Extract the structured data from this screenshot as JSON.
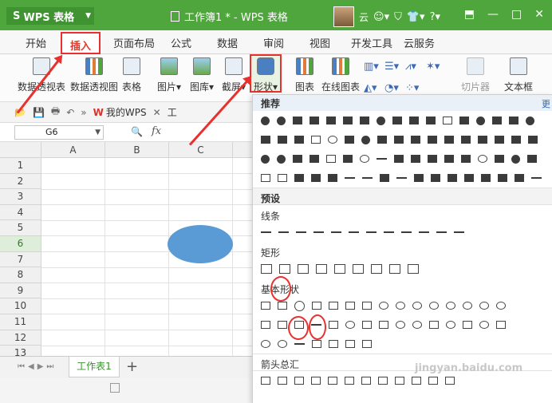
{
  "titlebar": {
    "app_name": "WPS 表格",
    "doc_title": "工作簿1 * - WPS 表格",
    "user_name": "云",
    "window_controls": [
      "restore-box",
      "minimize",
      "maximize",
      "close"
    ]
  },
  "menu": {
    "tabs": [
      "开始",
      "插入",
      "页面布局",
      "公式",
      "数据",
      "审阅",
      "视图",
      "开发工具",
      "云服务"
    ],
    "active_tab": "插入"
  },
  "ribbon": {
    "pivot_table": "数据透视表",
    "pivot_chart": "数据透视图",
    "table": "表格",
    "picture": "图片",
    "gallery": "图库",
    "screenshot": "截屏",
    "shapes": "形状",
    "chart": "图表",
    "online_chart": "在线图表",
    "slicer": "切片器",
    "textbox": "文本框"
  },
  "quick_access": {
    "my_wps": "我的WPS",
    "doc_tab_fragment": "工"
  },
  "formula_bar": {
    "name_box": "G6",
    "fx": "fx"
  },
  "grid": {
    "columns": [
      "A",
      "B",
      "C"
    ],
    "rows": [
      "1",
      "2",
      "3",
      "4",
      "5",
      "6",
      "7",
      "8",
      "9",
      "10",
      "11",
      "12",
      "13"
    ],
    "selected_row": "6"
  },
  "sheets": {
    "tab": "工作表1",
    "add": "+"
  },
  "shapes_panel": {
    "recommended": "推荐",
    "more": "更",
    "preset": "预设",
    "lines": "线条",
    "rectangles": "矩形",
    "basic_shapes": "基本形状",
    "block_arrows": "箭头总汇"
  },
  "watermark": "jingyan.baidu.com",
  "colors": {
    "titlebar": "#4fa63c",
    "highlight": "#e8312f",
    "ellipse": "#5b9bd5"
  }
}
